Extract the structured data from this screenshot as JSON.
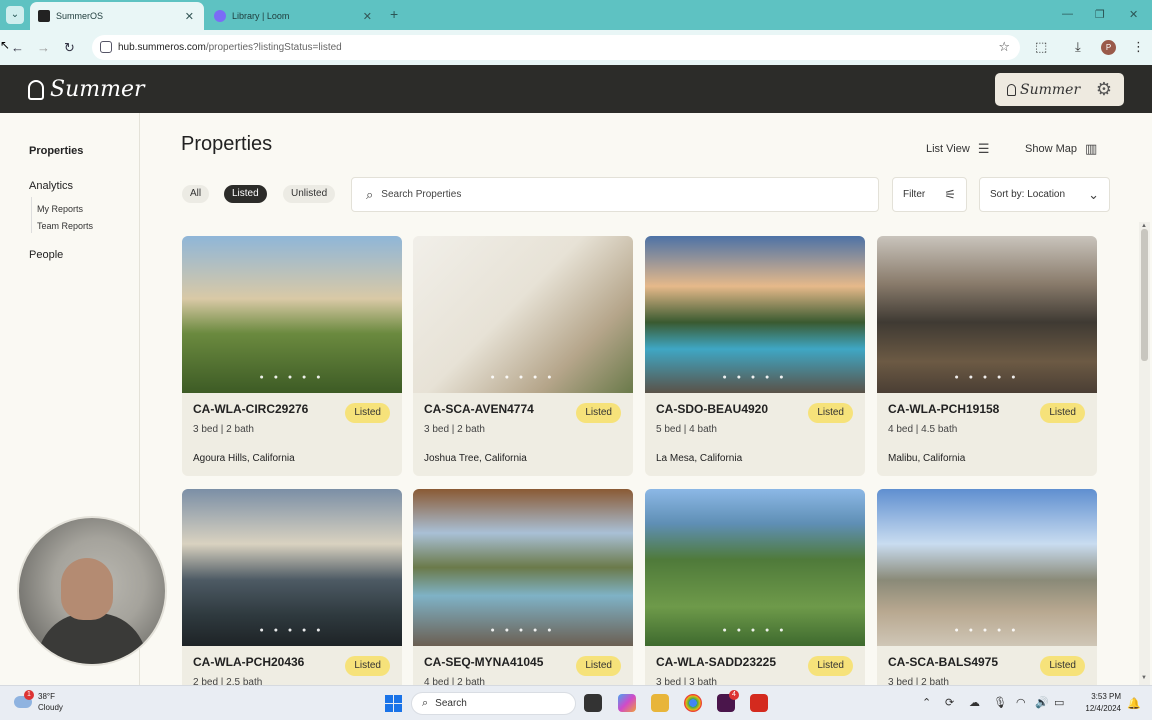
{
  "browser": {
    "tabs": [
      {
        "title": "SummerOS",
        "active": true
      },
      {
        "title": "Library | Loom",
        "active": false
      }
    ],
    "url": {
      "host": "hub.summeros.com",
      "path": "/properties?listingStatus=listed"
    }
  },
  "header": {
    "brand": "Summer",
    "brand_small": "Summer"
  },
  "sidebar": {
    "properties": "Properties",
    "analytics": "Analytics",
    "my_reports": "My Reports",
    "team_reports": "Team Reports",
    "people": "People"
  },
  "main": {
    "title": "Properties",
    "list_view": "List View",
    "show_map": "Show Map",
    "filters": {
      "all": "All",
      "listed": "Listed",
      "unlisted": "Unlisted"
    },
    "search_placeholder": "Search Properties",
    "filter_label": "Filter",
    "sort_label": "Sort by: Location"
  },
  "properties": [
    {
      "id": "CA-WLA-CIRC29276",
      "status": "Listed",
      "beds": "3 bed | 2 bath",
      "location": "Agoura Hills, California"
    },
    {
      "id": "CA-SCA-AVEN4774",
      "status": "Listed",
      "beds": "3 bed | 2 bath",
      "location": "Joshua Tree, California"
    },
    {
      "id": "CA-SDO-BEAU4920",
      "status": "Listed",
      "beds": "5 bed | 4 bath",
      "location": "La Mesa, California"
    },
    {
      "id": "CA-WLA-PCH19158",
      "status": "Listed",
      "beds": "4 bed | 4.5 bath",
      "location": "Malibu, California"
    },
    {
      "id": "CA-WLA-PCH20436",
      "status": "Listed",
      "beds": "2 bed | 2.5 bath",
      "location": ""
    },
    {
      "id": "CA-SEQ-MYNA41045",
      "status": "Listed",
      "beds": "4 bed | 2 bath",
      "location": ""
    },
    {
      "id": "CA-WLA-SADD23225",
      "status": "Listed",
      "beds": "3 bed | 3 bath",
      "location": ""
    },
    {
      "id": "CA-SCA-BALS4975",
      "status": "Listed",
      "beds": "3 bed | 2 bath",
      "location": ""
    }
  ],
  "taskbar": {
    "temp": "38°F",
    "condition": "Cloudy",
    "weather_alert": "1",
    "search": "Search",
    "badge": "4",
    "time": "3:53 PM",
    "date": "12/4/2024"
  },
  "colors": {
    "tabbar": "#5ec2c2",
    "header": "#2c2c29",
    "listed_badge": "#f6e27a",
    "page_bg": "#faf9f3"
  }
}
